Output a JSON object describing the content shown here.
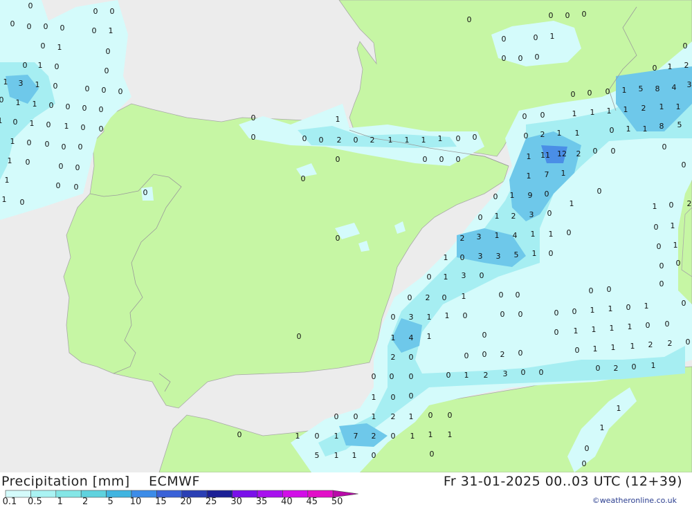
{
  "header": {
    "title": "Precipitation [mm]",
    "source": "ECMWF",
    "datetime": "Fr 31-01-2025 00..03 UTC (12+39)",
    "credit": "©weatheronline.co.uk"
  },
  "legend": {
    "labels": [
      "0.1",
      "0.5",
      "1",
      "2",
      "5",
      "10",
      "15",
      "20",
      "25",
      "30",
      "35",
      "40",
      "45",
      "50"
    ],
    "colors": [
      "#d4fbfb",
      "#aaf3f3",
      "#84e6e6",
      "#5fd2de",
      "#40b4e0",
      "#3c8ce8",
      "#3a62d8",
      "#2a3fb4",
      "#1b1f96",
      "#7a10ea",
      "#a810ee",
      "#d20ee8",
      "#e20ec8",
      "#b80aa8"
    ]
  },
  "colors": {
    "land": "#c6f6a4",
    "sea": "#ececec",
    "border": "#9a9a9a",
    "precip_light": "#d4fbfb",
    "precip_mid": "#a6eef2",
    "precip_heavy": "#6ec8ea",
    "precip_max": "#4a8ee6"
  },
  "values": [
    [
      "0",
      44,
      8
    ],
    [
      "0",
      138,
      16
    ],
    [
      "0",
      162,
      16
    ],
    [
      "0",
      18,
      34
    ],
    [
      "0",
      42,
      38
    ],
    [
      "0",
      66,
      38
    ],
    [
      "0",
      90,
      40
    ],
    [
      "0",
      136,
      44
    ],
    [
      "1",
      160,
      44
    ],
    [
      "0",
      62,
      66
    ],
    [
      "1",
      86,
      68
    ],
    [
      "0",
      156,
      74
    ],
    [
      "0",
      36,
      94
    ],
    [
      "1",
      58,
      94
    ],
    [
      "0",
      82,
      96
    ],
    [
      "0",
      154,
      102
    ],
    [
      "1",
      8,
      118
    ],
    [
      "3",
      30,
      120
    ],
    [
      "1",
      54,
      122
    ],
    [
      "0",
      80,
      124
    ],
    [
      "0",
      126,
      128
    ],
    [
      "0",
      150,
      130
    ],
    [
      "0",
      174,
      132
    ],
    [
      "0",
      2,
      144
    ],
    [
      "1",
      26,
      148
    ],
    [
      "1",
      50,
      150
    ],
    [
      "0",
      74,
      152
    ],
    [
      "0",
      98,
      154
    ],
    [
      "0",
      122,
      156
    ],
    [
      "0",
      146,
      158
    ],
    [
      "1",
      0,
      174
    ],
    [
      "0",
      22,
      176
    ],
    [
      "1",
      46,
      178
    ],
    [
      "0",
      70,
      180
    ],
    [
      "1",
      96,
      182
    ],
    [
      "0",
      120,
      184
    ],
    [
      "0",
      146,
      186
    ],
    [
      "1",
      18,
      204
    ],
    [
      "0",
      42,
      206
    ],
    [
      "0",
      68,
      208
    ],
    [
      "0",
      92,
      212
    ],
    [
      "0",
      116,
      212
    ],
    [
      "1",
      14,
      232
    ],
    [
      "0",
      40,
      234
    ],
    [
      "0",
      88,
      240
    ],
    [
      "0",
      112,
      242
    ],
    [
      "1",
      10,
      260
    ],
    [
      "0",
      84,
      268
    ],
    [
      "0",
      110,
      270
    ],
    [
      "1",
      6,
      288
    ],
    [
      "0",
      32,
      292
    ],
    [
      "0",
      210,
      278
    ],
    [
      "0",
      366,
      170
    ],
    [
      "1",
      488,
      172
    ],
    [
      "0",
      366,
      198
    ],
    [
      "0",
      440,
      200
    ],
    [
      "0",
      464,
      202
    ],
    [
      "2",
      490,
      202
    ],
    [
      "0",
      514,
      202
    ],
    [
      "2",
      538,
      202
    ],
    [
      "1",
      564,
      202
    ],
    [
      "1",
      588,
      202
    ],
    [
      "1",
      612,
      202
    ],
    [
      "1",
      636,
      200
    ],
    [
      "0",
      662,
      200
    ],
    [
      "0",
      686,
      198
    ],
    [
      "0",
      488,
      230
    ],
    [
      "0",
      614,
      230
    ],
    [
      "0",
      638,
      230
    ],
    [
      "0",
      662,
      230
    ],
    [
      "0",
      438,
      258
    ],
    [
      "0",
      488,
      344
    ],
    [
      "0",
      432,
      486
    ],
    [
      "0",
      678,
      28
    ],
    [
      "0",
      796,
      22
    ],
    [
      "0",
      820,
      22
    ],
    [
      "0",
      844,
      20
    ],
    [
      "0",
      728,
      56
    ],
    [
      "0",
      774,
      54
    ],
    [
      "1",
      798,
      52
    ],
    [
      "0",
      728,
      84
    ],
    [
      "0",
      752,
      84
    ],
    [
      "0",
      776,
      82
    ],
    [
      "0",
      990,
      66
    ],
    [
      "0",
      946,
      98
    ],
    [
      "1",
      968,
      96
    ],
    [
      "2",
      992,
      94
    ],
    [
      "0",
      828,
      136
    ],
    [
      "0",
      852,
      134
    ],
    [
      "0",
      878,
      132
    ],
    [
      "1",
      902,
      130
    ],
    [
      "5",
      926,
      128
    ],
    [
      "8",
      950,
      128
    ],
    [
      "4",
      974,
      126
    ],
    [
      "3",
      996,
      122
    ],
    [
      "0",
      758,
      168
    ],
    [
      "0",
      784,
      166
    ],
    [
      "1",
      830,
      164
    ],
    [
      "1",
      856,
      162
    ],
    [
      "1",
      880,
      160
    ],
    [
      "1",
      904,
      158
    ],
    [
      "2",
      930,
      156
    ],
    [
      "1",
      956,
      154
    ],
    [
      "1",
      980,
      154
    ],
    [
      "0",
      760,
      196
    ],
    [
      "2",
      784,
      194
    ],
    [
      "1",
      808,
      192
    ],
    [
      "1",
      834,
      192
    ],
    [
      "0",
      884,
      188
    ],
    [
      "1",
      908,
      186
    ],
    [
      "1",
      932,
      186
    ],
    [
      "8",
      956,
      182
    ],
    [
      "5",
      982,
      180
    ],
    [
      "0",
      960,
      212
    ],
    [
      "1",
      764,
      226
    ],
    [
      "11",
      788,
      224
    ],
    [
      "12",
      812,
      222
    ],
    [
      "2",
      836,
      222
    ],
    [
      "0",
      860,
      218
    ],
    [
      "0",
      886,
      218
    ],
    [
      "0",
      988,
      238
    ],
    [
      "1",
      764,
      254
    ],
    [
      "7",
      790,
      252
    ],
    [
      "1",
      814,
      250
    ],
    [
      "0",
      866,
      276
    ],
    [
      "0",
      716,
      284
    ],
    [
      "1",
      740,
      282
    ],
    [
      "9",
      766,
      282
    ],
    [
      "0",
      790,
      280
    ],
    [
      "1",
      826,
      294
    ],
    [
      "1",
      946,
      298
    ],
    [
      "0",
      970,
      296
    ],
    [
      "2",
      996,
      294
    ],
    [
      "0",
      694,
      314
    ],
    [
      "1",
      718,
      312
    ],
    [
      "2",
      742,
      312
    ],
    [
      "3",
      768,
      310
    ],
    [
      "0",
      794,
      308
    ],
    [
      "0",
      948,
      328
    ],
    [
      "1",
      972,
      326
    ],
    [
      "2",
      668,
      344
    ],
    [
      "3",
      692,
      342
    ],
    [
      "1",
      718,
      340
    ],
    [
      "4",
      744,
      340
    ],
    [
      "1",
      770,
      338
    ],
    [
      "1",
      796,
      338
    ],
    [
      "0",
      822,
      336
    ],
    [
      "0",
      952,
      356
    ],
    [
      "1",
      976,
      354
    ],
    [
      "1",
      644,
      372
    ],
    [
      "0",
      668,
      372
    ],
    [
      "3",
      694,
      370
    ],
    [
      "3",
      720,
      370
    ],
    [
      "5",
      746,
      368
    ],
    [
      "1",
      772,
      366
    ],
    [
      "0",
      796,
      366
    ],
    [
      "0",
      956,
      384
    ],
    [
      "0",
      980,
      380
    ],
    [
      "0",
      620,
      400
    ],
    [
      "1",
      644,
      400
    ],
    [
      "3",
      670,
      398
    ],
    [
      "0",
      696,
      398
    ],
    [
      "0",
      956,
      410
    ],
    [
      "0",
      592,
      430
    ],
    [
      "2",
      618,
      430
    ],
    [
      "0",
      642,
      430
    ],
    [
      "1",
      670,
      428
    ],
    [
      "0",
      724,
      426
    ],
    [
      "0",
      748,
      426
    ],
    [
      "0",
      854,
      420
    ],
    [
      "0",
      880,
      418
    ],
    [
      "0",
      988,
      438
    ],
    [
      "0",
      568,
      458
    ],
    [
      "3",
      594,
      458
    ],
    [
      "1",
      620,
      458
    ],
    [
      "1",
      646,
      456
    ],
    [
      "0",
      672,
      456
    ],
    [
      "0",
      726,
      454
    ],
    [
      "0",
      752,
      454
    ],
    [
      "0",
      804,
      452
    ],
    [
      "0",
      830,
      450
    ],
    [
      "1",
      856,
      448
    ],
    [
      "1",
      882,
      446
    ],
    [
      "0",
      908,
      444
    ],
    [
      "1",
      934,
      442
    ],
    [
      "1",
      568,
      488
    ],
    [
      "4",
      594,
      488
    ],
    [
      "1",
      620,
      486
    ],
    [
      "0",
      700,
      484
    ],
    [
      "0",
      804,
      480
    ],
    [
      "1",
      832,
      478
    ],
    [
      "1",
      858,
      476
    ],
    [
      "1",
      884,
      474
    ],
    [
      "1",
      910,
      472
    ],
    [
      "0",
      936,
      470
    ],
    [
      "0",
      964,
      468
    ],
    [
      "2",
      568,
      516
    ],
    [
      "0",
      594,
      516
    ],
    [
      "0",
      674,
      514
    ],
    [
      "0",
      700,
      512
    ],
    [
      "2",
      726,
      512
    ],
    [
      "0",
      752,
      510
    ],
    [
      "0",
      834,
      506
    ],
    [
      "1",
      860,
      504
    ],
    [
      "1",
      886,
      502
    ],
    [
      "1",
      914,
      500
    ],
    [
      "2",
      940,
      498
    ],
    [
      "2",
      968,
      496
    ],
    [
      "0",
      994,
      494
    ],
    [
      "0",
      540,
      544
    ],
    [
      "0",
      566,
      544
    ],
    [
      "0",
      594,
      544
    ],
    [
      "0",
      648,
      542
    ],
    [
      "1",
      674,
      542
    ],
    [
      "2",
      702,
      542
    ],
    [
      "3",
      730,
      540
    ],
    [
      "0",
      756,
      538
    ],
    [
      "0",
      782,
      538
    ],
    [
      "0",
      864,
      532
    ],
    [
      "2",
      890,
      532
    ],
    [
      "0",
      916,
      530
    ],
    [
      "1",
      944,
      528
    ],
    [
      "1",
      540,
      574
    ],
    [
      "0",
      568,
      574
    ],
    [
      "0",
      594,
      572
    ],
    [
      "1",
      894,
      590
    ],
    [
      "0",
      486,
      602
    ],
    [
      "0",
      514,
      602
    ],
    [
      "1",
      540,
      602
    ],
    [
      "2",
      568,
      602
    ],
    [
      "1",
      594,
      602
    ],
    [
      "0",
      622,
      600
    ],
    [
      "0",
      650,
      600
    ],
    [
      "0",
      346,
      628
    ],
    [
      "1",
      430,
      630
    ],
    [
      "0",
      458,
      630
    ],
    [
      "1",
      486,
      630
    ],
    [
      "7",
      514,
      630
    ],
    [
      "2",
      540,
      630
    ],
    [
      "0",
      568,
      630
    ],
    [
      "1",
      596,
      630
    ],
    [
      "1",
      622,
      628
    ],
    [
      "1",
      650,
      628
    ],
    [
      "1",
      870,
      618
    ],
    [
      "0",
      848,
      648
    ],
    [
      "5",
      458,
      658
    ],
    [
      "1",
      486,
      658
    ],
    [
      "1",
      512,
      658
    ],
    [
      "0",
      540,
      658
    ],
    [
      "0",
      624,
      656
    ],
    [
      "0",
      844,
      670
    ]
  ]
}
